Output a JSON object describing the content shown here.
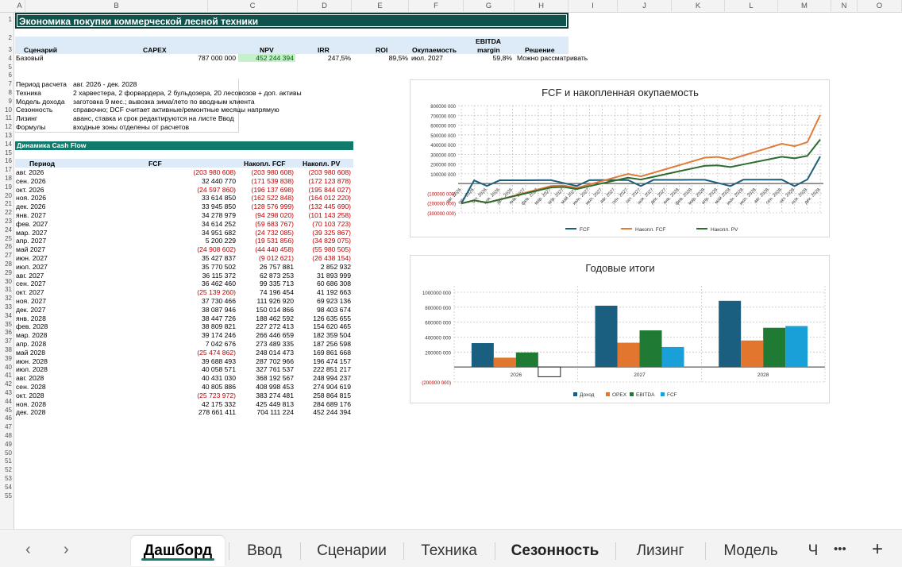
{
  "columns": [
    "A",
    "B",
    "C",
    "D",
    "E",
    "F",
    "G",
    "H",
    "I",
    "J",
    "K",
    "L",
    "M",
    "N",
    "O"
  ],
  "title": "Экономика покупки коммерческой лесной техники",
  "kpi": {
    "headers": {
      "scenario": "Сценарий",
      "capex": "CAPEX",
      "npv": "NPV",
      "irr": "IRR",
      "roi": "ROI",
      "payback": "Окупаемость",
      "ebitda_margin_line1": "EBITDA",
      "ebitda_margin_line2": "margin",
      "decision": "Решение"
    },
    "row": {
      "scenario": "Базовый",
      "capex": "787 000 000",
      "npv": "452 244 394",
      "irr": "247,5%",
      "roi": "89,5%",
      "payback": "июл. 2027",
      "ebitda_margin": "59,8%",
      "decision": "Можно рассматривать"
    }
  },
  "params": [
    {
      "label": "Период расчета",
      "value": "авг. 2026 - дек. 2028"
    },
    {
      "label": "Техника",
      "value": "2 харвестера, 2 форвардера, 2 бульдозера, 20 лесовозов + доп. активы"
    },
    {
      "label": "Модель дохода",
      "value": "заготовка 9 мес.; вывозка зима/лето по вводным клиента"
    },
    {
      "label": "Сезонность",
      "value": "справочно; DCF считает активные/ремонтные месяцы напрямую"
    },
    {
      "label": "Лизинг",
      "value": "аванс, ставка и срок редактируются на листе Ввод"
    },
    {
      "label": "Формулы",
      "value": "входные зоны отделены от расчетов"
    }
  ],
  "cashflow": {
    "section_title": "Динамика Cash Flow",
    "headers": {
      "period": "Период",
      "fcf": "FCF",
      "cum_fcf": "Накопл. FCF",
      "cum_pv": "Накопл. PV"
    },
    "rows": [
      {
        "period": "авг. 2026",
        "fcf": "(203 980 608)",
        "cum": "(203 980 608)",
        "pv": "(203 980 608)"
      },
      {
        "period": "сен. 2026",
        "fcf": "32 440 770",
        "cum": "(171 539 838)",
        "pv": "(172 123 878)"
      },
      {
        "period": "окт. 2026",
        "fcf": "(24 597 860)",
        "cum": "(196 137 698)",
        "pv": "(195 844 027)"
      },
      {
        "period": "ноя. 2026",
        "fcf": "33 614 850",
        "cum": "(162 522 848)",
        "pv": "(164 012 220)"
      },
      {
        "period": "дек. 2026",
        "fcf": "33 945 850",
        "cum": "(128 576 999)",
        "pv": "(132 445 690)"
      },
      {
        "period": "янв. 2027",
        "fcf": "34 278 979",
        "cum": "(94 298 020)",
        "pv": "(101 143 258)"
      },
      {
        "period": "фев. 2027",
        "fcf": "34 614 252",
        "cum": "(59 683 767)",
        "pv": "(70 103 723)"
      },
      {
        "period": "мар. 2027",
        "fcf": "34 951 682",
        "cum": "(24 732 085)",
        "pv": "(39 325 867)"
      },
      {
        "period": "апр. 2027",
        "fcf": "5 200 229",
        "cum": "(19 531 856)",
        "pv": "(34 829 075)"
      },
      {
        "period": "май 2027",
        "fcf": "(24 908 602)",
        "cum": "(44 440 458)",
        "pv": "(55 980 505)"
      },
      {
        "period": "июн. 2027",
        "fcf": "35 427 837",
        "cum": "(9 012 621)",
        "pv": "(26 438 154)"
      },
      {
        "period": "июл. 2027",
        "fcf": "35 770 502",
        "cum": "26 757 881",
        "pv": "2 852 932"
      },
      {
        "period": "авг. 2027",
        "fcf": "36 115 372",
        "cum": "62 873 253",
        "pv": "31 893 999"
      },
      {
        "period": "сен. 2027",
        "fcf": "36 462 460",
        "cum": "99 335 713",
        "pv": "60 686 308"
      },
      {
        "period": "окт. 2027",
        "fcf": "(25 139 260)",
        "cum": "74 196 454",
        "pv": "41 192 663"
      },
      {
        "period": "ноя. 2027",
        "fcf": "37 730 466",
        "cum": "111 926 920",
        "pv": "69 923 136"
      },
      {
        "period": "дек. 2027",
        "fcf": "38 087 946",
        "cum": "150 014 866",
        "pv": "98 403 674"
      },
      {
        "period": "янв. 2028",
        "fcf": "38 447 726",
        "cum": "188 462 592",
        "pv": "126 635 655"
      },
      {
        "period": "фев. 2028",
        "fcf": "38 809 821",
        "cum": "227 272 413",
        "pv": "154 620 465"
      },
      {
        "period": "мар. 2028",
        "fcf": "39 174 246",
        "cum": "266 446 659",
        "pv": "182 359 504"
      },
      {
        "period": "апр. 2028",
        "fcf": "7 042 676",
        "cum": "273 489 335",
        "pv": "187 256 598"
      },
      {
        "period": "май 2028",
        "fcf": "(25 474 862)",
        "cum": "248 014 473",
        "pv": "169 861 668"
      },
      {
        "period": "июн. 2028",
        "fcf": "39 688 493",
        "cum": "287 702 966",
        "pv": "196 474 157"
      },
      {
        "period": "июл. 2028",
        "fcf": "40 058 571",
        "cum": "327 761 537",
        "pv": "222 851 217"
      },
      {
        "period": "авг. 2028",
        "fcf": "40 431 030",
        "cum": "368 192 567",
        "pv": "248 994 237"
      },
      {
        "period": "сен. 2028",
        "fcf": "40 805 886",
        "cum": "408 998 453",
        "pv": "274 904 619"
      },
      {
        "period": "окт. 2028",
        "fcf": "(25 723 972)",
        "cum": "383 274 481",
        "pv": "258 864 815"
      },
      {
        "period": "ноя. 2028",
        "fcf": "42 175 332",
        "cum": "425 449 813",
        "pv": "284 689 176"
      },
      {
        "period": "дек. 2028",
        "fcf": "278 661 411",
        "cum": "704 111 224",
        "pv": "452 244 394"
      }
    ]
  },
  "chart_data": [
    {
      "type": "line",
      "title": "FCF и накопленная окупаемость",
      "x": [
        "авг. 2026",
        "сен. 2026",
        "окт. 2026",
        "ноя. 2026",
        "дек. 2026",
        "янв. 2027",
        "фев. 2027",
        "мар. 2027",
        "апр. 2027",
        "май 2027",
        "июн. 2027",
        "июл. 2027",
        "авг. 2027",
        "сен. 2027",
        "окт. 2027",
        "ноя. 2027",
        "дек. 2027",
        "янв. 2028",
        "фев. 2028",
        "мар. 2028",
        "апр. 2028",
        "май 2028",
        "июн. 2028",
        "июл. 2028",
        "авг. 2028",
        "сен. 2028",
        "окт. 2028",
        "ноя. 2028",
        "дек. 2028"
      ],
      "series": [
        {
          "name": "FCF",
          "color": "#1f5f7d",
          "values": [
            -203980608,
            32440770,
            -24597860,
            33614850,
            33945850,
            34278979,
            34614252,
            34951682,
            5200229,
            -24908602,
            35427837,
            35770502,
            36115372,
            36462460,
            -25139260,
            37730466,
            38087946,
            38447726,
            38809821,
            39174246,
            7042676,
            -25474862,
            39688493,
            40058571,
            40431030,
            40805886,
            -25723972,
            42175332,
            278661411
          ]
        },
        {
          "name": "Накопл. FCF",
          "color": "#e07b39",
          "values": [
            -203980608,
            -171539838,
            -196137698,
            -162522848,
            -128576999,
            -94298020,
            -59683767,
            -24732085,
            -19531856,
            -44440458,
            -9012621,
            26757881,
            62873253,
            99335713,
            74196454,
            111926920,
            150014866,
            188462592,
            227272413,
            266446659,
            273489335,
            248014473,
            287702966,
            327761537,
            368192567,
            408998453,
            383274481,
            425449813,
            704111224
          ]
        },
        {
          "name": "Накопл. PV",
          "color": "#2e6b2e",
          "values": [
            -203980608,
            -172123878,
            -195844027,
            -164012220,
            -132445690,
            -101143258,
            -70103723,
            -39325867,
            -34829075,
            -55980505,
            -26438154,
            2852932,
            31893999,
            60686308,
            41192663,
            69923136,
            98403674,
            126635655,
            154620465,
            182359504,
            187256598,
            169861668,
            196474157,
            222851217,
            248994237,
            274904619,
            258864815,
            284689176,
            452244394
          ]
        }
      ],
      "yticks": [
        "800000 000",
        "700000 000",
        "600000 000",
        "500000 000",
        "400000 000",
        "300000 000",
        "200000 000",
        "100000 000",
        "",
        "(100000 000)",
        "(200000 000)",
        "(300000 000)"
      ],
      "ylim": [
        -300000000,
        800000000
      ],
      "grid": true,
      "legend": "bottom"
    },
    {
      "type": "bar",
      "title": "Годовые итоги",
      "categories": [
        "2026",
        "2027",
        "2028"
      ],
      "series": [
        {
          "name": "Доход",
          "color": "#1a5e80",
          "values": [
            320000000,
            820000000,
            885000000
          ]
        },
        {
          "name": "OPEX",
          "color": "#e3762f",
          "values": [
            125000000,
            325000000,
            355000000
          ]
        },
        {
          "name": "EBITDA",
          "color": "#1f7a34",
          "values": [
            195000000,
            490000000,
            525000000
          ]
        },
        {
          "name": "FCF",
          "color": "#1aa0d8",
          "values": [
            -130000000,
            268000000,
            548000000
          ]
        }
      ],
      "yticks": [
        "1000000 000",
        "800000 000",
        "600000 000",
        "400000 000",
        "200000 000",
        "",
        "(200000 000)"
      ],
      "ylim": [
        -200000000,
        1000000000
      ],
      "grid": true,
      "legend": "bottom"
    }
  ],
  "tabs": {
    "items": [
      "Дашборд",
      "Ввод",
      "Сценарии",
      "Техника",
      "Сезонность",
      "Лизинг",
      "Модель",
      "Ч"
    ],
    "more": "•••",
    "add": "+",
    "prev": "‹",
    "next": "›"
  }
}
